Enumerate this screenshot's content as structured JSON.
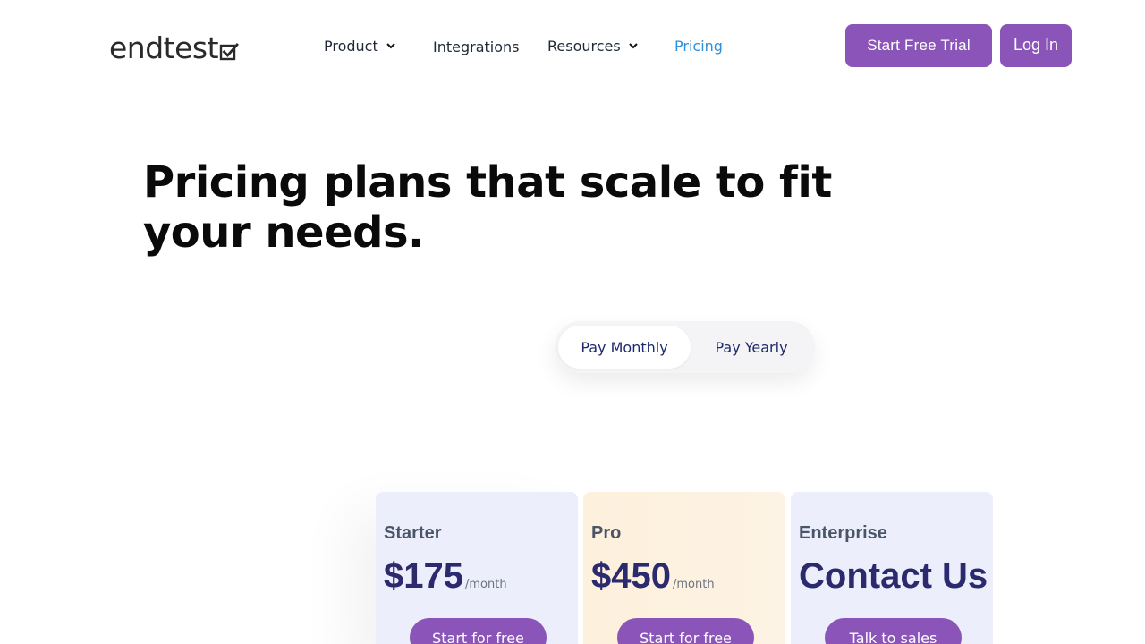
{
  "header": {
    "logo_text": "endtest",
    "nav": [
      {
        "label": "Product",
        "has_dropdown": true
      },
      {
        "label": "Integrations",
        "has_dropdown": false
      },
      {
        "label": "Resources",
        "has_dropdown": true
      },
      {
        "label": "Pricing",
        "has_dropdown": false,
        "active": true
      }
    ],
    "trial_button": "Start Free Trial",
    "login_button": "Log In"
  },
  "hero": {
    "title": "Pricing plans that scale to fit your needs."
  },
  "billing_toggle": {
    "options": [
      "Pay Monthly",
      "Pay Yearly"
    ],
    "selected": "Pay Monthly"
  },
  "plans": [
    {
      "name": "Starter",
      "price": "$175",
      "period": "/month",
      "cta": "Start for free"
    },
    {
      "name": "Pro",
      "price": "$450",
      "period": "/month",
      "cta": "Start for free"
    },
    {
      "name": "Enterprise",
      "price": "Contact Us",
      "period": "",
      "cta": "Talk to sales"
    }
  ],
  "colors": {
    "accent": "#8b54b8",
    "active_nav": "#2f8fd8",
    "price_text": "#2b2a6f",
    "starter_bg": "#eceefc",
    "pro_bg": "#fdf0dc",
    "enterprise_bg": "#eceefc"
  },
  "icons": {
    "logo_mark": "checkbox-check-icon",
    "dropdown": "chevron-down-icon"
  }
}
